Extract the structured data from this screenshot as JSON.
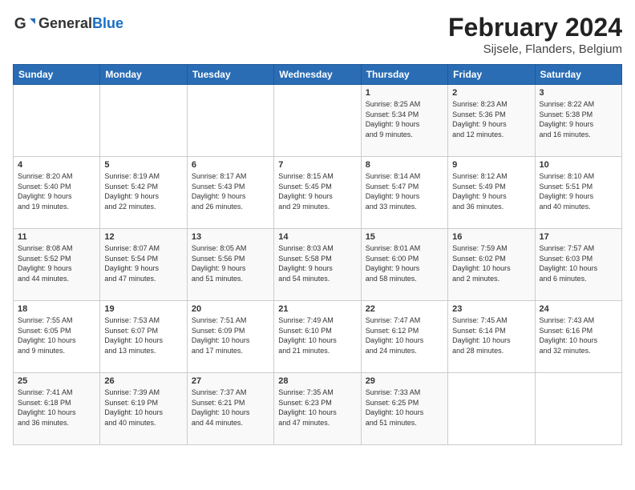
{
  "header": {
    "logo_general": "General",
    "logo_blue": "Blue",
    "month_year": "February 2024",
    "location": "Sijsele, Flanders, Belgium"
  },
  "calendar": {
    "days_of_week": [
      "Sunday",
      "Monday",
      "Tuesday",
      "Wednesday",
      "Thursday",
      "Friday",
      "Saturday"
    ],
    "weeks": [
      [
        {
          "day": "",
          "info": ""
        },
        {
          "day": "",
          "info": ""
        },
        {
          "day": "",
          "info": ""
        },
        {
          "day": "",
          "info": ""
        },
        {
          "day": "1",
          "info": "Sunrise: 8:25 AM\nSunset: 5:34 PM\nDaylight: 9 hours\nand 9 minutes."
        },
        {
          "day": "2",
          "info": "Sunrise: 8:23 AM\nSunset: 5:36 PM\nDaylight: 9 hours\nand 12 minutes."
        },
        {
          "day": "3",
          "info": "Sunrise: 8:22 AM\nSunset: 5:38 PM\nDaylight: 9 hours\nand 16 minutes."
        }
      ],
      [
        {
          "day": "4",
          "info": "Sunrise: 8:20 AM\nSunset: 5:40 PM\nDaylight: 9 hours\nand 19 minutes."
        },
        {
          "day": "5",
          "info": "Sunrise: 8:19 AM\nSunset: 5:42 PM\nDaylight: 9 hours\nand 22 minutes."
        },
        {
          "day": "6",
          "info": "Sunrise: 8:17 AM\nSunset: 5:43 PM\nDaylight: 9 hours\nand 26 minutes."
        },
        {
          "day": "7",
          "info": "Sunrise: 8:15 AM\nSunset: 5:45 PM\nDaylight: 9 hours\nand 29 minutes."
        },
        {
          "day": "8",
          "info": "Sunrise: 8:14 AM\nSunset: 5:47 PM\nDaylight: 9 hours\nand 33 minutes."
        },
        {
          "day": "9",
          "info": "Sunrise: 8:12 AM\nSunset: 5:49 PM\nDaylight: 9 hours\nand 36 minutes."
        },
        {
          "day": "10",
          "info": "Sunrise: 8:10 AM\nSunset: 5:51 PM\nDaylight: 9 hours\nand 40 minutes."
        }
      ],
      [
        {
          "day": "11",
          "info": "Sunrise: 8:08 AM\nSunset: 5:52 PM\nDaylight: 9 hours\nand 44 minutes."
        },
        {
          "day": "12",
          "info": "Sunrise: 8:07 AM\nSunset: 5:54 PM\nDaylight: 9 hours\nand 47 minutes."
        },
        {
          "day": "13",
          "info": "Sunrise: 8:05 AM\nSunset: 5:56 PM\nDaylight: 9 hours\nand 51 minutes."
        },
        {
          "day": "14",
          "info": "Sunrise: 8:03 AM\nSunset: 5:58 PM\nDaylight: 9 hours\nand 54 minutes."
        },
        {
          "day": "15",
          "info": "Sunrise: 8:01 AM\nSunset: 6:00 PM\nDaylight: 9 hours\nand 58 minutes."
        },
        {
          "day": "16",
          "info": "Sunrise: 7:59 AM\nSunset: 6:02 PM\nDaylight: 10 hours\nand 2 minutes."
        },
        {
          "day": "17",
          "info": "Sunrise: 7:57 AM\nSunset: 6:03 PM\nDaylight: 10 hours\nand 6 minutes."
        }
      ],
      [
        {
          "day": "18",
          "info": "Sunrise: 7:55 AM\nSunset: 6:05 PM\nDaylight: 10 hours\nand 9 minutes."
        },
        {
          "day": "19",
          "info": "Sunrise: 7:53 AM\nSunset: 6:07 PM\nDaylight: 10 hours\nand 13 minutes."
        },
        {
          "day": "20",
          "info": "Sunrise: 7:51 AM\nSunset: 6:09 PM\nDaylight: 10 hours\nand 17 minutes."
        },
        {
          "day": "21",
          "info": "Sunrise: 7:49 AM\nSunset: 6:10 PM\nDaylight: 10 hours\nand 21 minutes."
        },
        {
          "day": "22",
          "info": "Sunrise: 7:47 AM\nSunset: 6:12 PM\nDaylight: 10 hours\nand 24 minutes."
        },
        {
          "day": "23",
          "info": "Sunrise: 7:45 AM\nSunset: 6:14 PM\nDaylight: 10 hours\nand 28 minutes."
        },
        {
          "day": "24",
          "info": "Sunrise: 7:43 AM\nSunset: 6:16 PM\nDaylight: 10 hours\nand 32 minutes."
        }
      ],
      [
        {
          "day": "25",
          "info": "Sunrise: 7:41 AM\nSunset: 6:18 PM\nDaylight: 10 hours\nand 36 minutes."
        },
        {
          "day": "26",
          "info": "Sunrise: 7:39 AM\nSunset: 6:19 PM\nDaylight: 10 hours\nand 40 minutes."
        },
        {
          "day": "27",
          "info": "Sunrise: 7:37 AM\nSunset: 6:21 PM\nDaylight: 10 hours\nand 44 minutes."
        },
        {
          "day": "28",
          "info": "Sunrise: 7:35 AM\nSunset: 6:23 PM\nDaylight: 10 hours\nand 47 minutes."
        },
        {
          "day": "29",
          "info": "Sunrise: 7:33 AM\nSunset: 6:25 PM\nDaylight: 10 hours\nand 51 minutes."
        },
        {
          "day": "",
          "info": ""
        },
        {
          "day": "",
          "info": ""
        }
      ]
    ]
  }
}
